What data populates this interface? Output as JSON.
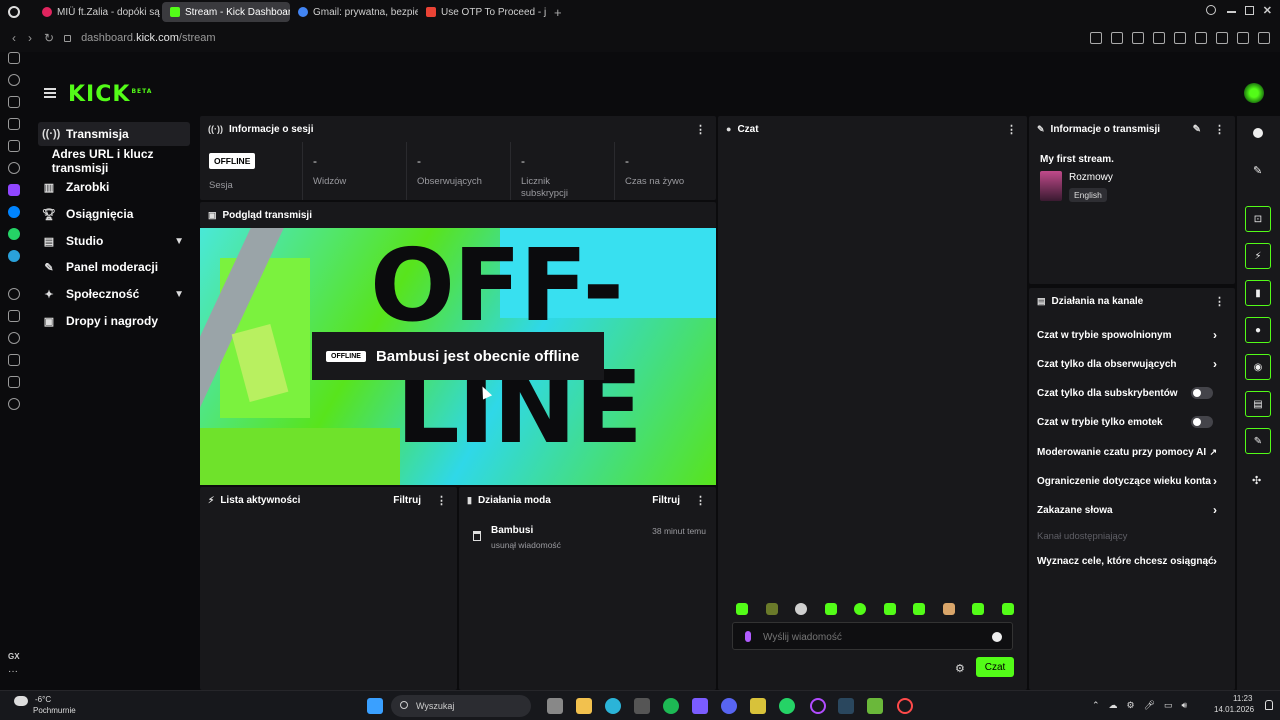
{
  "browser": {
    "tabs": [
      {
        "label": "MIÜ ft.Zalia - dopóki są"
      },
      {
        "label": "Stream - Kick Dashboard"
      },
      {
        "label": "Gmail: prywatna, bezpieczn"
      },
      {
        "label": "Use OTP To Proceed - jakie"
      }
    ],
    "url_prefix": "dashboard.",
    "url_domain": "kick.com",
    "url_path": "/stream"
  },
  "app": {
    "logo": "KICK",
    "logo_badge": "BETA"
  },
  "nav": [
    {
      "label": "Transmisja"
    },
    {
      "label": "Adres URL i klucz transmisji"
    },
    {
      "label": "Zarobki"
    },
    {
      "label": "Osiągnięcia"
    },
    {
      "label": "Studio"
    },
    {
      "label": "Panel moderacji"
    },
    {
      "label": "Społeczność"
    },
    {
      "label": "Dropy i nagrody"
    }
  ],
  "session": {
    "title": "Informacje o sesji",
    "status": "OFFLINE",
    "status_label": "Sesja",
    "stats": [
      {
        "value": "-",
        "label": "Widzów"
      },
      {
        "value": "-",
        "label": "Obserwujących"
      },
      {
        "value": "-",
        "label": "Licznik subskrypcji"
      },
      {
        "value": "-",
        "label": "Czas na żywo"
      }
    ]
  },
  "preview": {
    "title": "Podgląd transmisji",
    "badge": "OFFLINE",
    "message": "Bambusi jest obecnie offline",
    "art_text_1": "OFF-",
    "art_text_2": "LINE"
  },
  "activity": {
    "title": "Lista aktywności",
    "filter": "Filtruj"
  },
  "modactions": {
    "title": "Działania moda",
    "filter": "Filtruj",
    "items": [
      {
        "user": "Bambusi",
        "action": "usunął wiadomość",
        "time": "38 minut temu"
      }
    ]
  },
  "chat": {
    "title": "Czat",
    "placeholder": "Wyślij wiadomość",
    "send": "Czat"
  },
  "streaminfo": {
    "title": "Informacje o transmisji",
    "stream_title": "My first stream.",
    "category": "Rozmowy",
    "language": "English"
  },
  "channel": {
    "title": "Działania na kanale",
    "items": [
      {
        "label": "Czat w trybie spowolnionym",
        "kind": "arrow"
      },
      {
        "label": "Czat tylko dla obserwujących",
        "kind": "arrow"
      },
      {
        "label": "Czat tylko dla subskrybentów",
        "kind": "toggle"
      },
      {
        "label": "Czat w trybie tylko emotek",
        "kind": "toggle"
      },
      {
        "label": "Moderowanie czatu przy pomocy AI",
        "kind": "ext"
      },
      {
        "label": "Ograniczenie dotyczące wieku konta",
        "kind": "arrow"
      },
      {
        "label": "Zakazane słowa",
        "kind": "arrow"
      },
      {
        "label": "Kanał udostępniający",
        "kind": "disabled"
      },
      {
        "label": "Wyznacz cele, które chcesz osiągnąć",
        "kind": "arrow"
      }
    ]
  },
  "taskbar": {
    "temp": "-6°C",
    "weather": "Pochmurnie",
    "search": "Wyszukaj",
    "time": "11:23",
    "date": "14.01.2026"
  },
  "gx": {
    "label": "GX"
  },
  "colors": {
    "accent": "#53fc18",
    "bg": "#0b0b0d",
    "panel": "#18181b"
  }
}
